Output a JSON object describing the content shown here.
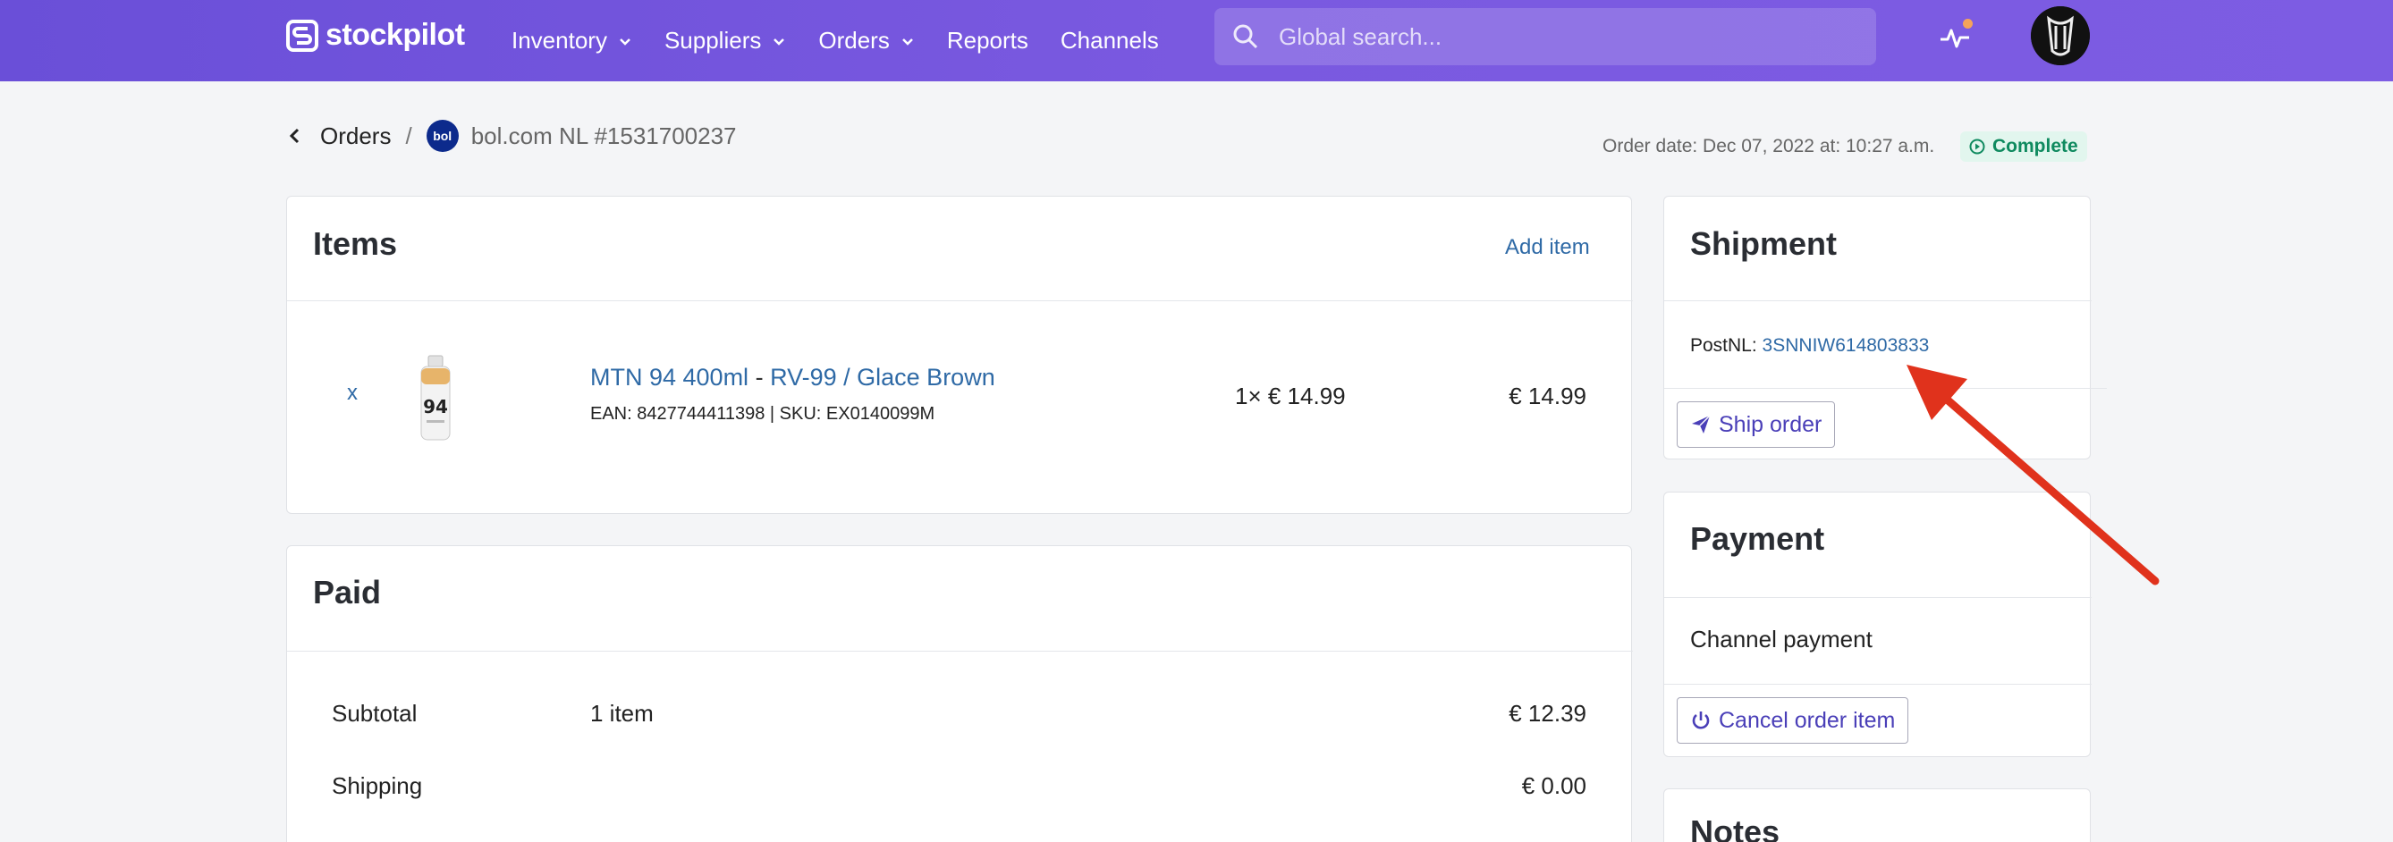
{
  "nav": {
    "brand": "stockpilot",
    "menu": [
      {
        "label": "Inventory",
        "has_dropdown": true
      },
      {
        "label": "Suppliers",
        "has_dropdown": true
      },
      {
        "label": "Orders",
        "has_dropdown": true
      },
      {
        "label": "Reports",
        "has_dropdown": false
      },
      {
        "label": "Channels",
        "has_dropdown": false
      }
    ],
    "search_placeholder": "Global search...",
    "icons": {
      "search": "search-icon",
      "activity": "activity-pulse-icon",
      "avatar": "user-avatar"
    },
    "notification_dot_color": "#f5a35a"
  },
  "breadcrumb": {
    "parent": "Orders",
    "separator": "/",
    "channel_logo_text": "bol",
    "order_ref": "bol.com NL #1531700237"
  },
  "order_date": "Order date: Dec 07, 2022 at: 10:27 a.m.",
  "status": {
    "label": "Complete",
    "color": "#0f8a5f",
    "bg": "#e2f6ee"
  },
  "items": {
    "title": "Items",
    "add_label": "Add item",
    "rows": [
      {
        "remove": "x",
        "name": "MTN 94 400ml",
        "dash": "-",
        "variant": "RV-99 / Glace Brown",
        "meta": "EAN: 8427744411398 | SKU: EX0140099M",
        "qty_price": "1× € 14.99",
        "total": "€ 14.99"
      }
    ]
  },
  "paid": {
    "title": "Paid",
    "rows": [
      {
        "label": "Subtotal",
        "detail": "1 item",
        "amount": "€ 12.39"
      },
      {
        "label": "Shipping",
        "detail": "",
        "amount": "€ 0.00"
      }
    ]
  },
  "shipment": {
    "title": "Shipment",
    "carrier": "PostNL:",
    "tracking": "3SNNIW614803833",
    "ship_label": "Ship order"
  },
  "payment": {
    "title": "Payment",
    "method": "Channel payment",
    "cancel_label": "Cancel order item"
  },
  "notes": {
    "title": "Notes"
  },
  "colors": {
    "nav": "#7456dc",
    "link": "#2f6aa6",
    "button_text": "#4a3fb8",
    "annotation_arrow": "#e0321c"
  }
}
